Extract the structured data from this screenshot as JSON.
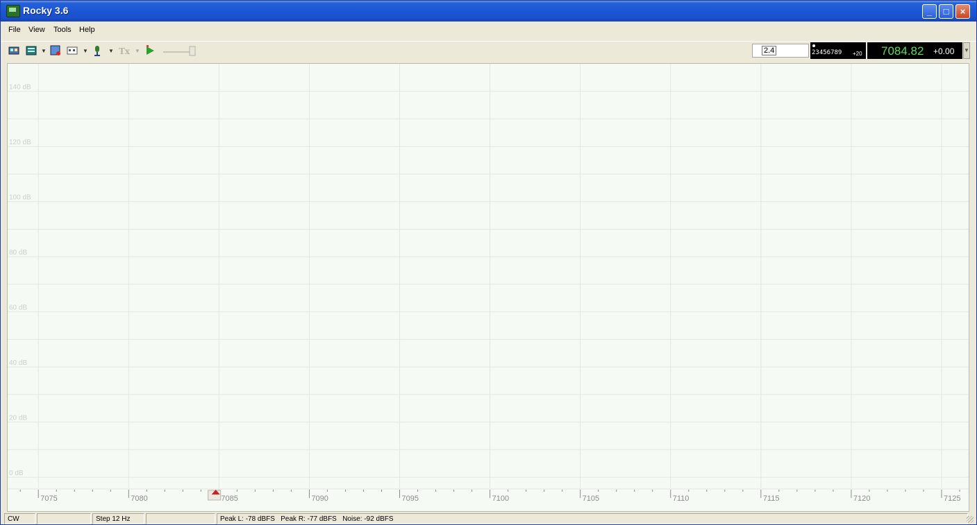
{
  "window": {
    "title": "Rocky 3.6",
    "controls": {
      "minimize": "_",
      "maximize": "□",
      "close": "×"
    }
  },
  "menu": {
    "items": [
      "File",
      "View",
      "Tools",
      "Help"
    ]
  },
  "toolbar": {
    "icons": [
      "sound-card-icon",
      "display-mode-icon",
      "waterfall-icon",
      "memory-icon",
      "microphone-icon",
      "tx-icon",
      "play-icon",
      "volume-slider"
    ],
    "gain_value": "2.4",
    "digit_scale": "23456789",
    "digit_offset": "+20",
    "frequency": "7084.82",
    "rit_offset": "+0.00"
  },
  "spectrum": {
    "db_labels": [
      "140 dB",
      "120 dB",
      "100 dB",
      "80 dB",
      "60 dB",
      "40 dB",
      "20 dB",
      "0 dB"
    ],
    "freq_labels": [
      "7075",
      "7080",
      "7085",
      "7090",
      "7095",
      "7100",
      "7105",
      "7110",
      "7115",
      "7120",
      "7125"
    ],
    "freq_min": 7073.3,
    "freq_max": 7126.5,
    "db_min": -4,
    "db_max": 150,
    "tuned_marker_freq": 7084.82,
    "colors": {
      "background": "#f6faf5",
      "grid": "#dfe8e0",
      "label": "#c8d2c9",
      "scale": "#8a8a8a",
      "marker": "#cc2222"
    }
  },
  "status": {
    "mode": "CW",
    "empty1": "",
    "step": "Step 12 Hz",
    "empty2": "",
    "levels": "Peak L: -78 dBFS   Peak R: -77 dBFS   Noise: -92 dBFS"
  }
}
